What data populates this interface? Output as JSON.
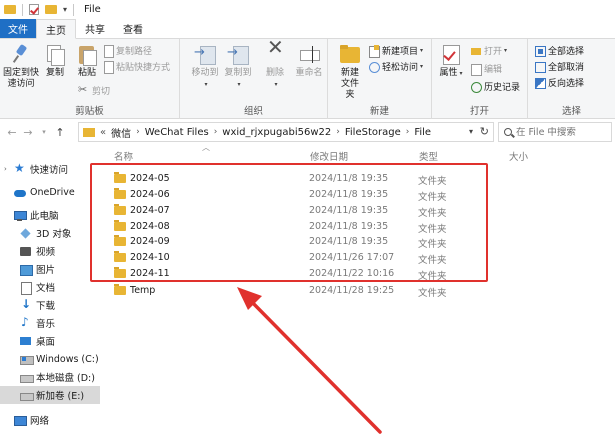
{
  "window": {
    "title": "File"
  },
  "ribbon_tabs": [
    {
      "label": "文件"
    },
    {
      "label": "主页"
    },
    {
      "label": "共享"
    },
    {
      "label": "查看"
    }
  ],
  "ribbon": {
    "clipboard": {
      "pin_label": "固定到快速访问",
      "copy_label": "复制",
      "paste_label": "粘贴",
      "copy_path_label": "复制路径",
      "paste_shortcut_label": "粘贴快捷方式",
      "cut_label": "剪切",
      "group_label": "剪贴板"
    },
    "organize": {
      "move_label": "移动到",
      "copyto_label": "复制到",
      "delete_label": "删除",
      "rename_label": "重命名",
      "group_label": "组织"
    },
    "new": {
      "new_folder_label": "新建文件夹",
      "new_item_label": "新建项目",
      "easy_access_label": "轻松访问",
      "group_label": "新建"
    },
    "open": {
      "properties_label": "属性",
      "open_label": "打开",
      "edit_label": "编辑",
      "history_label": "历史记录",
      "group_label": "打开"
    },
    "select": {
      "select_all_label": "全部选择",
      "select_none_label": "全部取消",
      "invert_label": "反向选择",
      "group_label": "选择"
    }
  },
  "address": {
    "prefix": "«",
    "crumbs": [
      "微信",
      "WeChat Files",
      "wxid_rjxpugabi56w22",
      "FileStorage",
      "File"
    ],
    "separator": "›"
  },
  "search": {
    "placeholder": "搜索\"File\"",
    "value": "在 File 中搜索"
  },
  "sidebar": {
    "items": [
      {
        "label": "快速访问"
      },
      {
        "label": "OneDrive"
      },
      {
        "label": "此电脑"
      },
      {
        "label": "3D 对象"
      },
      {
        "label": "视频"
      },
      {
        "label": "图片"
      },
      {
        "label": "文档"
      },
      {
        "label": "下载"
      },
      {
        "label": "音乐"
      },
      {
        "label": "桌面"
      },
      {
        "label": "Windows (C:)"
      },
      {
        "label": "本地磁盘 (D:)"
      },
      {
        "label": "新加卷 (E:)"
      },
      {
        "label": "网络"
      }
    ]
  },
  "columns": {
    "name": "名称",
    "date": "修改日期",
    "type": "类型",
    "size": "大小"
  },
  "files": [
    {
      "name": "2024-05",
      "date": "2024/11/8 19:35",
      "type": "文件夹"
    },
    {
      "name": "2024-06",
      "date": "2024/11/8 19:35",
      "type": "文件夹"
    },
    {
      "name": "2024-07",
      "date": "2024/11/8 19:35",
      "type": "文件夹"
    },
    {
      "name": "2024-08",
      "date": "2024/11/8 19:35",
      "type": "文件夹"
    },
    {
      "name": "2024-09",
      "date": "2024/11/8 19:35",
      "type": "文件夹"
    },
    {
      "name": "2024-10",
      "date": "2024/11/26 17:07",
      "type": "文件夹"
    },
    {
      "name": "2024-11",
      "date": "2024/11/22 10:16",
      "type": "文件夹"
    },
    {
      "name": "Temp",
      "date": "2024/11/28 19:25",
      "type": "文件夹"
    }
  ],
  "colors": {
    "accent": "#1f6fc5",
    "annotation": "#e0312d",
    "folder": "#e8b534"
  }
}
